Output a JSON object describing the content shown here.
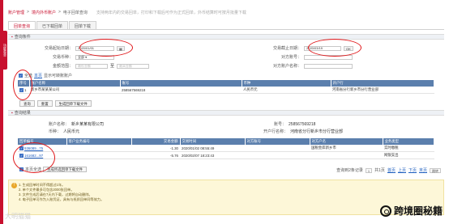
{
  "side_tab": "功能菜单",
  "breadcrumb": {
    "items": [
      "账户管理",
      "境内外币账户",
      "电子回单查询"
    ],
    "separator": ">",
    "tip": "支持两年内的交易回单，打印和下载后可作为正式回单，外币结算时可按月批量下载"
  },
  "tabs": [
    {
      "label": "回单查询",
      "active": true
    },
    {
      "label": "已下载回单",
      "active": false
    },
    {
      "label": "回单下载",
      "active": false
    }
  ],
  "query_section": {
    "title": "查询条件",
    "start_date_label": "交易起始日期：",
    "start_date_value": "2020/01/01",
    "end_date_label": "交易截止日期：",
    "end_date_value": "2020/03/19",
    "currency_label": "交易币种：",
    "currency_value": "全部",
    "counter_account_label": "对方账号：",
    "counter_account_placeholder": "",
    "amount_label": "金额范围：",
    "amount_min_placeholder": "最低金额",
    "amount_to": "至",
    "amount_max_placeholder": "最高金额",
    "counter_name_label": "对方账户名称：",
    "counter_name_placeholder": "",
    "select_all_label": "全选",
    "only_label": "本页",
    "show_accounts_text": "显示可转账账户",
    "account_table": {
      "headers": [
        "序号",
        "账户名称",
        "账号",
        "币种",
        "开户行"
      ],
      "rows": [
        [
          "1",
          "新乡市某某某公司",
          "258567569218",
          "人民币元",
          "河南省分行新乡市分行营业部"
        ]
      ]
    },
    "buttons": [
      "查询",
      "重置",
      "生成回单下载文件"
    ]
  },
  "result_section": {
    "title": "查询结果",
    "account_name_label": "账户名称：",
    "account_name_value": "新乡某某有限公司",
    "account_no_label": "账号：",
    "account_no_value": "258567569218",
    "currency_label": "币种：",
    "currency_value": "人民币元",
    "bank_label": "开户行名称：",
    "bank_value": "河南省分行新乡市分行营业部",
    "table": {
      "headers": [
        "回单编号",
        "客户业务编号",
        "交易金额",
        "交易时间",
        "对方账号",
        "对方户名",
        "业务类型"
      ],
      "rows": [
        {
          "id": "936089...75",
          "cust_no": "",
          "amount": "-1.30",
          "time": "2020/01/02 08:55:49",
          "counter_acct": "",
          "counter_name": "国税金库新乡市",
          "type": "实时缴税"
        },
        {
          "id": "161682...97",
          "cust_no": "",
          "amount": "-5.76",
          "time": "2020/02/07 18:23:43",
          "counter_acct": "",
          "counter_name": "",
          "type": "网银支出"
        }
      ]
    },
    "page_select_label": "本页全选",
    "gen_file_button": "生成所选回单下载文件",
    "pager": {
      "summary": "查询到2条记录",
      "current": "1",
      "total_text": "共1页",
      "first": "首页",
      "prev": "上页",
      "next": "下页",
      "last": "末页",
      "go": "跳转"
    }
  },
  "notice": {
    "lines": [
      "1. 生成回单时间不得超过1年。",
      "2. 单个文件最多可包含2000张回单。",
      "3. 文件生成后请在7天内下载，过期将自动删除。",
      "4. 电子回单可作为入账凭证，具有与纸质回单同等效力。"
    ]
  },
  "watermark": {
    "text": "跨境圈秘籍",
    "faint": "大明猫猫"
  }
}
